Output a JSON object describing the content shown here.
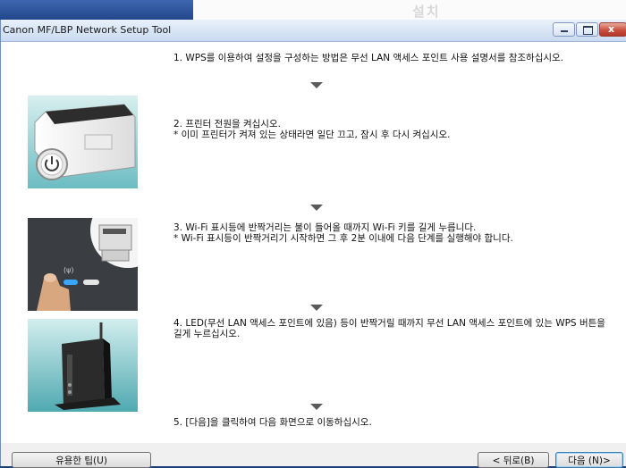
{
  "window": {
    "title": "Canon MF/LBP Network Setup Tool",
    "controls": [
      "minimize",
      "maximize",
      "close"
    ],
    "close_glyph": "x"
  },
  "background_text": "설치",
  "steps": [
    {
      "number": "1.",
      "lines": [
        "1. WPS를 이용하여 설정을 구성하는 방법은 무선 LAN 액세스 포인트 사용 설명서를 참조하십시오."
      ]
    },
    {
      "number": "2.",
      "lines": [
        "2. 프린터 전원을 켜십시오.",
        "* 이미 프린터가 켜져 있는 상태라면 일단 끄고, 잠시 후 다시 켜십시오."
      ]
    },
    {
      "number": "3.",
      "lines": [
        "3. Wi-Fi 표시등에 반짝거리는 불이 들어올 때까지 Wi-Fi 키를 길게 누릅니다.",
        "* Wi-Fi 표시등이 반짝거리기 시작하면 그 후 2분 이내에 다음 단계를 실행해야 합니다."
      ]
    },
    {
      "number": "4.",
      "lines": [
        "4. LED(무선 LAN 액세스 포인트에 있음) 등이 반짝거릴 때까지 무선 LAN 액세스 포인트에 있는 WPS 버튼을 길게 누르십시오."
      ]
    },
    {
      "number": "5.",
      "lines": [
        "5. [다음]을 클릭하여 다음 화면으로 이동하십시오."
      ]
    }
  ],
  "images": {
    "printer_power": {
      "icon": "power-icon"
    },
    "wifi_key": {
      "icon": "wifi-icon",
      "label": "(ψ)"
    },
    "access_point": {
      "icon": "router-icon"
    }
  },
  "buttons": {
    "tips": "유용한 팁(U)",
    "back": "< 뒤로(B)",
    "next": "다음 (N)>"
  },
  "colors": {
    "title_bar": "#d6e4f5",
    "close_button": "#c9503f",
    "wifi_led": "#3aa7ff",
    "desktop": "#1d3f78"
  }
}
